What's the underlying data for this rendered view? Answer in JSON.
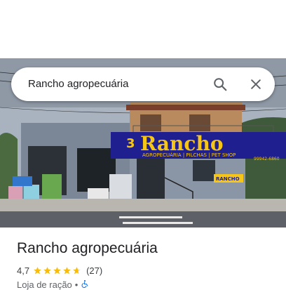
{
  "search": {
    "query": "Rancho agropecuária"
  },
  "photo": {
    "sign": {
      "number": "3",
      "name": "Rancho",
      "tagline": "AGROPECUÁRIA | PILCHAS | PET SHOP",
      "phone": "99942-6860"
    },
    "small_sign": "RANCHO"
  },
  "place": {
    "name": "Rancho agropecuária",
    "rating": "4,7",
    "stars": 4.7,
    "review_count": "(27)",
    "category": "Loja de ração",
    "separator": "•"
  },
  "icons": {
    "search": "search-icon",
    "close": "close-icon",
    "star": "star-icon",
    "accessibility": "wheelchair-accessible-icon"
  },
  "colors": {
    "star": "#fbbc04",
    "sign_blue": "#1f1f8f",
    "sign_yellow": "#f5c518",
    "accessibility": "#1a73e8"
  }
}
